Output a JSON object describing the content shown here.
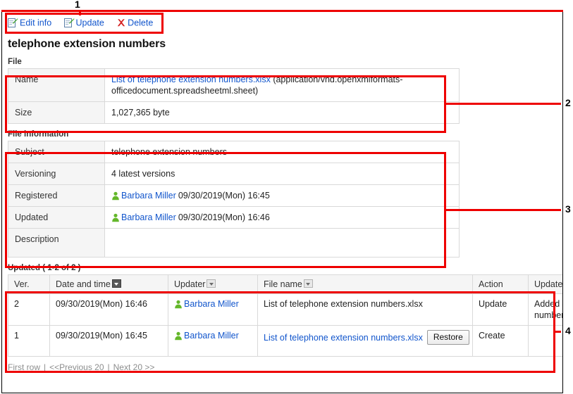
{
  "toolbar": {
    "items": [
      {
        "label": "Edit info",
        "icon": "edit-document-icon"
      },
      {
        "label": "Update",
        "icon": "update-document-icon"
      },
      {
        "label": "Delete",
        "icon": "delete-cross-icon"
      }
    ]
  },
  "page": {
    "title": "telephone extension numbers"
  },
  "file_section": {
    "caption": "File",
    "rows": [
      {
        "label": "Name",
        "link_text": "List of telephone extension numbers.xlsx",
        "mime": "(application/vnd.openxmlformats-officedocument.spreadsheetml.sheet)"
      },
      {
        "label": "Size",
        "value": "1,027,365 byte"
      }
    ]
  },
  "file_information": {
    "caption": "File information",
    "rows": [
      {
        "label": "Subject",
        "value": "telephone extension numbers"
      },
      {
        "label": "Versioning",
        "value": "4  latest versions"
      },
      {
        "label": "Registered",
        "user": "Barbara Miller",
        "datetime": "09/30/2019(Mon) 16:45"
      },
      {
        "label": "Updated",
        "user": "Barbara Miller",
        "datetime": "09/30/2019(Mon) 16:46"
      },
      {
        "label": "Description",
        "value": ""
      }
    ]
  },
  "history": {
    "caption": "Updated ( 1-2 of 2 )",
    "columns": [
      {
        "label": "Ver.",
        "sortable": false
      },
      {
        "label": "Date and time",
        "sortable": true,
        "sort_active": true
      },
      {
        "label": "Updater",
        "sortable": true,
        "sort_active": false
      },
      {
        "label": "File name",
        "sortable": true,
        "sort_active": false
      },
      {
        "label": "Action",
        "sortable": false
      },
      {
        "label": "Update comment",
        "sortable": false
      }
    ],
    "rows": [
      {
        "ver": "2",
        "datetime": "09/30/2019(Mon) 16:46",
        "updater": "Barbara Miller",
        "file_name": "List of telephone extension numbers.xlsx",
        "file_name_is_link": false,
        "restore_label": "",
        "has_restore": false,
        "action": "Update",
        "comment": "Added Joseph's number."
      },
      {
        "ver": "1",
        "datetime": "09/30/2019(Mon) 16:45",
        "updater": "Barbara Miller",
        "file_name": "List of telephone extension numbers.xlsx",
        "file_name_is_link": true,
        "restore_label": "Restore",
        "has_restore": true,
        "action": "Create",
        "comment": ""
      }
    ]
  },
  "pager": {
    "first": "First row",
    "previous": "<<Previous 20",
    "next": "Next 20 >>",
    "separator": "|"
  },
  "annotations": {
    "one": "1",
    "two": "2",
    "three": "3",
    "four": "4"
  },
  "colors": {
    "link": "#1155cc",
    "annotation": "#ee0000",
    "label_bg": "#f5f5f5",
    "border": "#d9d9d9",
    "user_icon": "#66bb22"
  }
}
